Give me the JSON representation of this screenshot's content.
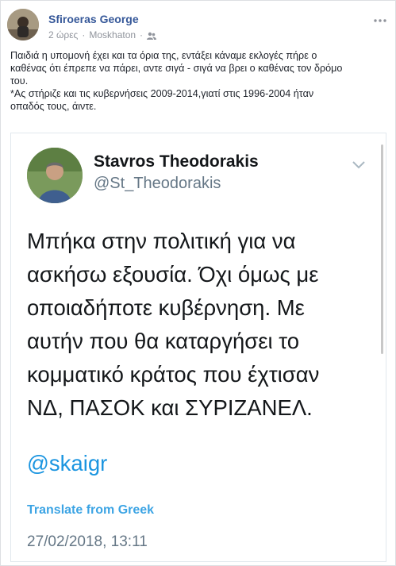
{
  "post": {
    "author": "Sfiroeras George",
    "time": "2 ώρες",
    "location": "Moskhaton",
    "separator": "·",
    "text_lines": [
      "Παιδιά η υπομονή έχει και τα όρια της, εντάξει κάναμε εκλογές πήρε ο",
      "καθένας ότι έπρεπε να πάρει, αντε σιγά - σιγά να βρει ο καθένας τον δρόμο",
      "του.",
      "*Ας στήριζε και τις κυβερνήσεις 2009-2014,γιατί στις 1996-2004 ήταν",
      "οπαδός τους, άιντε."
    ]
  },
  "tweet": {
    "name": "Stavros Theodorakis",
    "handle": "@St_Theodorakis",
    "body_lines": [
      "Μπήκα στην πολιτική για να",
      "ασκήσω εξουσία. Όχι όμως με",
      "οποιαδήποτε κυβέρνηση. Με",
      "αυτήν που θα καταργήσει το",
      "κομματικό κράτος που έχτισαν",
      "ΝΔ, ΠΑΣΟΚ και ΣΥΡΙΖΑΝΕΛ."
    ],
    "mention": "@skaigr",
    "translate": "Translate from Greek",
    "date": "27/02/2018, 13:11"
  },
  "icons": {
    "friends": "friends-icon",
    "more": "more-options-icon",
    "chevron": "chevron-down-icon"
  },
  "colors": {
    "author_link": "#365899",
    "twitter_blue": "#1b95e0",
    "muted": "#90949c"
  }
}
